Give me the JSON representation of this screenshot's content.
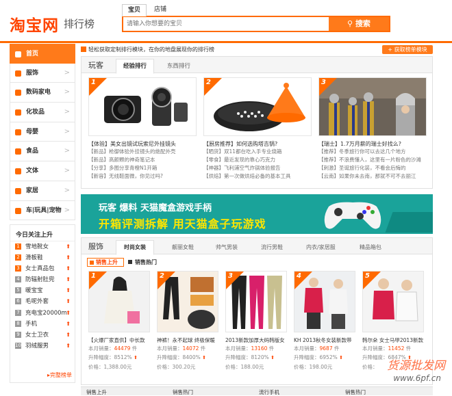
{
  "header": {
    "logo": "淘宝网",
    "subtitle": "排行榜",
    "search_tabs": [
      "宝贝",
      "店铺"
    ],
    "search_placeholder": "请输入你想要的宝贝",
    "search_button": "搜索"
  },
  "sidebar": {
    "items": [
      {
        "label": "首页",
        "active": true
      },
      {
        "label": "服饰"
      },
      {
        "label": "数码家电"
      },
      {
        "label": "化妆品"
      },
      {
        "label": "母婴"
      },
      {
        "label": "食品"
      },
      {
        "label": "文体"
      },
      {
        "label": "家居"
      },
      {
        "label": "车|玩具|宠物"
      }
    ]
  },
  "hot": {
    "title": "今日关注上升",
    "items": [
      {
        "rank": "1",
        "name": "雪地靴女"
      },
      {
        "rank": "2",
        "name": "滑板鞋"
      },
      {
        "rank": "3",
        "name": "女士真品包"
      },
      {
        "rank": "4",
        "name": "防辐射肚兜"
      },
      {
        "rank": "5",
        "name": "暖宝宝"
      },
      {
        "rank": "6",
        "name": "毛呢外套"
      },
      {
        "rank": "7",
        "name": "充电宝20000m"
      },
      {
        "rank": "8",
        "name": "手机"
      },
      {
        "rank": "9",
        "name": "女士卫衣"
      },
      {
        "rank": "10",
        "name": "羽绒服男"
      }
    ],
    "more": "完整榜单"
  },
  "topbar": {
    "text": "轻松获取定制排行模块，在你的地盘展现你的排行榜",
    "button": "获取榜单模块"
  },
  "play": {
    "title": "玩客",
    "tabs": [
      "经验排行",
      "东西排行"
    ],
    "columns": [
      {
        "rank": "1",
        "title": "【体验】美女出镜试玩索尼外挂镜头",
        "lines": [
          "【新品】枪御体验外挂镜头的绝配外壳",
          "【新品】高颜颗的神奇笔记本",
          "【分享】多图分享青橙N1开箱",
          "【新容】无线鞋面微，你见过吗?"
        ]
      },
      {
        "rank": "2",
        "title": "【厨房推荐】如何选购塔吉锅?",
        "lines": [
          "【晒货】双11都在吃入手专业烧箱",
          "【零食】最近发现的靠心巧克力",
          "【神器】飞利浦空气炸锅体验报告",
          "【烘焙】第一次做烘焙必备的基本工具"
        ]
      },
      {
        "rank": "3",
        "title": "【瑞士】1.7万月薪的瑞士好找么?",
        "lines": [
          "【推荐】冬季旅行你可以去这几个地方",
          "【推荐】不浪费懂人，这里有一片粉色的沙滩",
          "【刺激】圣诞旅行化装，不看会后悔的",
          "【云南】如果你未去南，那就不可不去丽江"
        ]
      }
    ]
  },
  "banner": {
    "line1": "玩客 爆料 天猫魔盒游戏手柄",
    "line2": "开箱评测拆解 用天猫盒子玩游戏"
  },
  "fashion": {
    "title": "服饰",
    "tabs": [
      "时尚女装",
      "靓丽女鞋",
      "帅气男装",
      "流行男鞋",
      "内衣/家居服",
      "精品箱包"
    ],
    "sort": [
      "销售上升",
      "销售热门"
    ],
    "products": [
      {
        "rank": "1",
        "name": "【火爆厂家直供】中长款",
        "sales": "44479",
        "growth": "8512%",
        "price": "1,388.00元"
      },
      {
        "rank": "2",
        "name": "神裤！永不起球 终极保暖",
        "sales": "14072",
        "growth": "8400%",
        "price": "300.20元"
      },
      {
        "rank": "3",
        "name": "2013新款加厚大码韩版女",
        "sales": "13160",
        "growth": "8120%",
        "price": "188.00元"
      },
      {
        "rank": "4",
        "name": "KH 2013秋冬女装新款带",
        "sales": "9687",
        "growth": "6952%",
        "price": "198.00元"
      },
      {
        "rank": "5",
        "name": "韩尔朵 女士马甲2013新款",
        "sales": "11452",
        "growth": "6847%",
        "price": ""
      }
    ],
    "labels": {
      "sales": "本月销量：",
      "growth": "升降幅度：",
      "price": "价格：",
      "unit": "件"
    }
  },
  "footer": [
    "销售上升",
    "销售热门",
    "流行手机",
    "销售热门"
  ],
  "watermark": {
    "line1": "货源批发网",
    "line2": "www.6pf.cn"
  },
  "colors": {
    "accent": "#ff6a00",
    "banner": "#1aa39a"
  }
}
